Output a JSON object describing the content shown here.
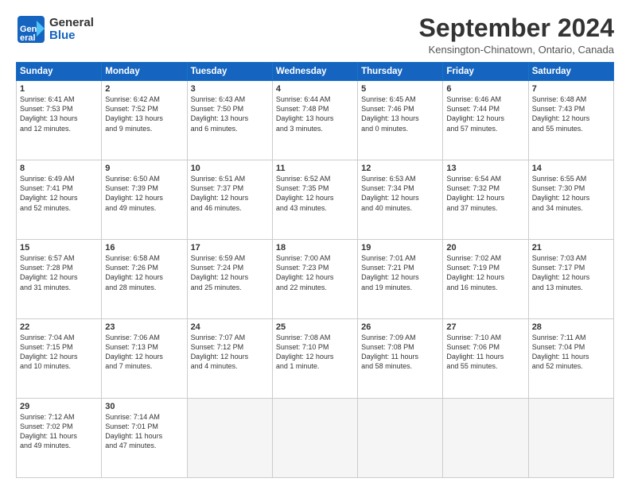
{
  "header": {
    "logo_line1": "General",
    "logo_line2": "Blue",
    "month": "September 2024",
    "location": "Kensington-Chinatown, Ontario, Canada"
  },
  "weekdays": [
    "Sunday",
    "Monday",
    "Tuesday",
    "Wednesday",
    "Thursday",
    "Friday",
    "Saturday"
  ],
  "weeks": [
    [
      {
        "day": "1",
        "info": "Sunrise: 6:41 AM\nSunset: 7:53 PM\nDaylight: 13 hours\nand 12 minutes."
      },
      {
        "day": "2",
        "info": "Sunrise: 6:42 AM\nSunset: 7:52 PM\nDaylight: 13 hours\nand 9 minutes."
      },
      {
        "day": "3",
        "info": "Sunrise: 6:43 AM\nSunset: 7:50 PM\nDaylight: 13 hours\nand 6 minutes."
      },
      {
        "day": "4",
        "info": "Sunrise: 6:44 AM\nSunset: 7:48 PM\nDaylight: 13 hours\nand 3 minutes."
      },
      {
        "day": "5",
        "info": "Sunrise: 6:45 AM\nSunset: 7:46 PM\nDaylight: 13 hours\nand 0 minutes."
      },
      {
        "day": "6",
        "info": "Sunrise: 6:46 AM\nSunset: 7:44 PM\nDaylight: 12 hours\nand 57 minutes."
      },
      {
        "day": "7",
        "info": "Sunrise: 6:48 AM\nSunset: 7:43 PM\nDaylight: 12 hours\nand 55 minutes."
      }
    ],
    [
      {
        "day": "8",
        "info": "Sunrise: 6:49 AM\nSunset: 7:41 PM\nDaylight: 12 hours\nand 52 minutes."
      },
      {
        "day": "9",
        "info": "Sunrise: 6:50 AM\nSunset: 7:39 PM\nDaylight: 12 hours\nand 49 minutes."
      },
      {
        "day": "10",
        "info": "Sunrise: 6:51 AM\nSunset: 7:37 PM\nDaylight: 12 hours\nand 46 minutes."
      },
      {
        "day": "11",
        "info": "Sunrise: 6:52 AM\nSunset: 7:35 PM\nDaylight: 12 hours\nand 43 minutes."
      },
      {
        "day": "12",
        "info": "Sunrise: 6:53 AM\nSunset: 7:34 PM\nDaylight: 12 hours\nand 40 minutes."
      },
      {
        "day": "13",
        "info": "Sunrise: 6:54 AM\nSunset: 7:32 PM\nDaylight: 12 hours\nand 37 minutes."
      },
      {
        "day": "14",
        "info": "Sunrise: 6:55 AM\nSunset: 7:30 PM\nDaylight: 12 hours\nand 34 minutes."
      }
    ],
    [
      {
        "day": "15",
        "info": "Sunrise: 6:57 AM\nSunset: 7:28 PM\nDaylight: 12 hours\nand 31 minutes."
      },
      {
        "day": "16",
        "info": "Sunrise: 6:58 AM\nSunset: 7:26 PM\nDaylight: 12 hours\nand 28 minutes."
      },
      {
        "day": "17",
        "info": "Sunrise: 6:59 AM\nSunset: 7:24 PM\nDaylight: 12 hours\nand 25 minutes."
      },
      {
        "day": "18",
        "info": "Sunrise: 7:00 AM\nSunset: 7:23 PM\nDaylight: 12 hours\nand 22 minutes."
      },
      {
        "day": "19",
        "info": "Sunrise: 7:01 AM\nSunset: 7:21 PM\nDaylight: 12 hours\nand 19 minutes."
      },
      {
        "day": "20",
        "info": "Sunrise: 7:02 AM\nSunset: 7:19 PM\nDaylight: 12 hours\nand 16 minutes."
      },
      {
        "day": "21",
        "info": "Sunrise: 7:03 AM\nSunset: 7:17 PM\nDaylight: 12 hours\nand 13 minutes."
      }
    ],
    [
      {
        "day": "22",
        "info": "Sunrise: 7:04 AM\nSunset: 7:15 PM\nDaylight: 12 hours\nand 10 minutes."
      },
      {
        "day": "23",
        "info": "Sunrise: 7:06 AM\nSunset: 7:13 PM\nDaylight: 12 hours\nand 7 minutes."
      },
      {
        "day": "24",
        "info": "Sunrise: 7:07 AM\nSunset: 7:12 PM\nDaylight: 12 hours\nand 4 minutes."
      },
      {
        "day": "25",
        "info": "Sunrise: 7:08 AM\nSunset: 7:10 PM\nDaylight: 12 hours\nand 1 minute."
      },
      {
        "day": "26",
        "info": "Sunrise: 7:09 AM\nSunset: 7:08 PM\nDaylight: 11 hours\nand 58 minutes."
      },
      {
        "day": "27",
        "info": "Sunrise: 7:10 AM\nSunset: 7:06 PM\nDaylight: 11 hours\nand 55 minutes."
      },
      {
        "day": "28",
        "info": "Sunrise: 7:11 AM\nSunset: 7:04 PM\nDaylight: 11 hours\nand 52 minutes."
      }
    ],
    [
      {
        "day": "29",
        "info": "Sunrise: 7:12 AM\nSunset: 7:02 PM\nDaylight: 11 hours\nand 49 minutes."
      },
      {
        "day": "30",
        "info": "Sunrise: 7:14 AM\nSunset: 7:01 PM\nDaylight: 11 hours\nand 47 minutes."
      },
      {
        "day": "",
        "info": ""
      },
      {
        "day": "",
        "info": ""
      },
      {
        "day": "",
        "info": ""
      },
      {
        "day": "",
        "info": ""
      },
      {
        "day": "",
        "info": ""
      }
    ]
  ]
}
